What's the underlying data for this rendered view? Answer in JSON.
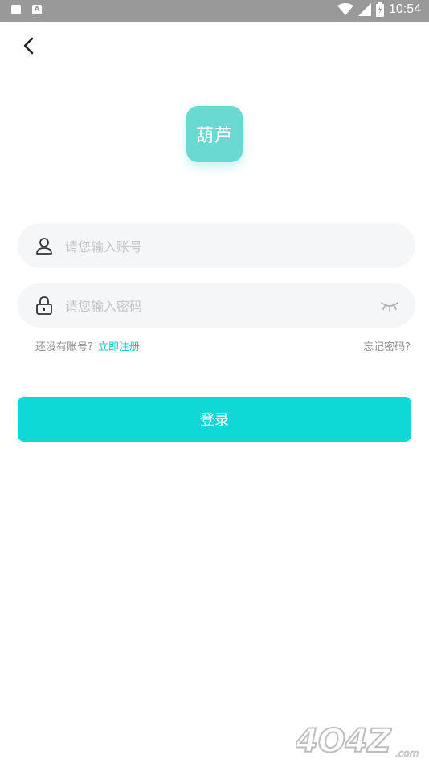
{
  "status_bar": {
    "time": "10:54"
  },
  "logo": {
    "text": "葫芦"
  },
  "account_field": {
    "placeholder": "请您输入账号"
  },
  "password_field": {
    "placeholder": "请您输入密码"
  },
  "links": {
    "no_account": "还没有账号?",
    "register": "立即注册",
    "forgot": "忘记密码?"
  },
  "login_button": {
    "label": "登录"
  },
  "watermark": {
    "text": "4O4Z",
    "suffix": ".com"
  },
  "colors": {
    "accent": "#0fd9d6",
    "logo_bg": "#6ad9d2",
    "link": "#15c6c6"
  },
  "icons": [
    "back-arrow-icon",
    "user-icon",
    "lock-icon",
    "eye-closed-icon"
  ]
}
